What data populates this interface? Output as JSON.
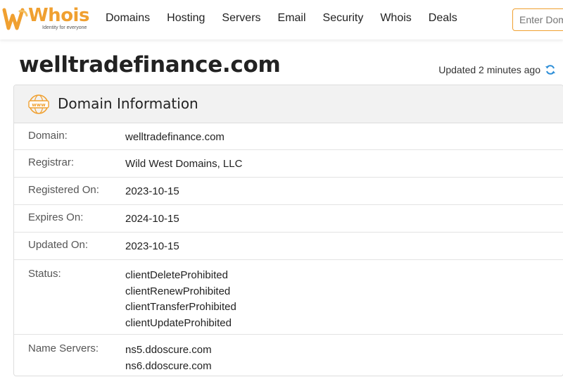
{
  "brand": {
    "name": "Whois",
    "tagline": "Identity for everyone",
    "accent_color": "#f0a030"
  },
  "nav": {
    "items": [
      "Domains",
      "Hosting",
      "Servers",
      "Email",
      "Security",
      "Whois",
      "Deals"
    ]
  },
  "search": {
    "placeholder": "Enter Domain"
  },
  "page": {
    "title": "welltradefinance.com",
    "updated_text": "Updated 2 minutes ago",
    "refresh_icon": "refresh-icon"
  },
  "card": {
    "icon": "www-globe-icon",
    "title": "Domain Information",
    "rows": [
      {
        "label": "Domain:",
        "values": [
          "welltradefinance.com"
        ]
      },
      {
        "label": "Registrar:",
        "values": [
          "Wild West Domains, LLC"
        ]
      },
      {
        "label": "Registered On:",
        "values": [
          "2023-10-15"
        ]
      },
      {
        "label": "Expires On:",
        "values": [
          "2024-10-15"
        ]
      },
      {
        "label": "Updated On:",
        "values": [
          "2023-10-15"
        ]
      },
      {
        "label": "Status:",
        "values": [
          "clientDeleteProhibited",
          "clientRenewProhibited",
          "clientTransferProhibited",
          "clientUpdateProhibited"
        ]
      },
      {
        "label": "Name Servers:",
        "values": [
          "ns5.ddoscure.com",
          "ns6.ddoscure.com"
        ]
      }
    ]
  }
}
